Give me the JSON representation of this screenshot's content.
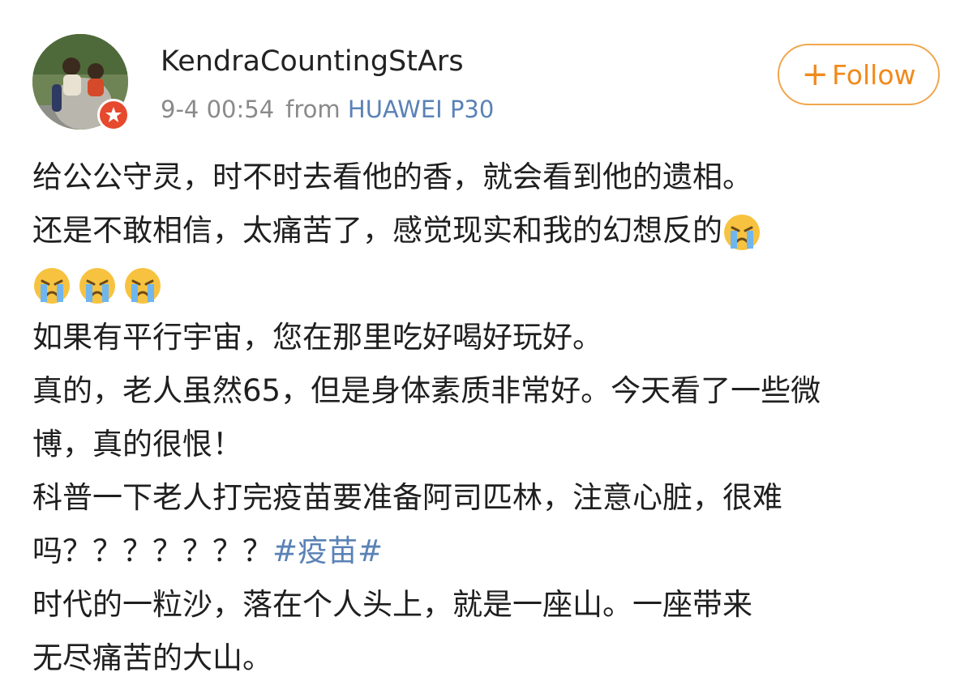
{
  "post": {
    "author": {
      "name": "KendraCountingStArs",
      "verified_badge": "weibo-verified-icon"
    },
    "meta": {
      "time": "9-4 00:54",
      "from_label": "from",
      "device": "HUAWEI P30"
    },
    "follow_label": "Follow",
    "content": {
      "line1": "给公公守灵，时不时去看他的香，就会看到他的遗相。",
      "line2": "还是不敢相信，太痛苦了，感觉现实和我的幻想反的",
      "line4": "如果有平行宇宙，您在那里吃好喝好玩好。",
      "line5": "真的，老人虽然65，但是身体素质非常好。今天看了一些微",
      "line6": "博，真的很恨！",
      "line7": "科普一下老人打完疫苗要准备阿司匹林，注意心脏，很难",
      "line8_text": "吗？？？？？？？",
      "hashtag": "#疫苗#",
      "line9": "时代的一粒沙，落在个人头上，就是一座山。一座带来",
      "line10": "无尽痛苦的大山。"
    },
    "emoji_name": "crying-face-emoji",
    "colors": {
      "accent_orange": "#f08a1c",
      "link_blue": "#5a82b6",
      "meta_gray": "#8a8a8a",
      "verified_red": "#e6492d"
    }
  }
}
